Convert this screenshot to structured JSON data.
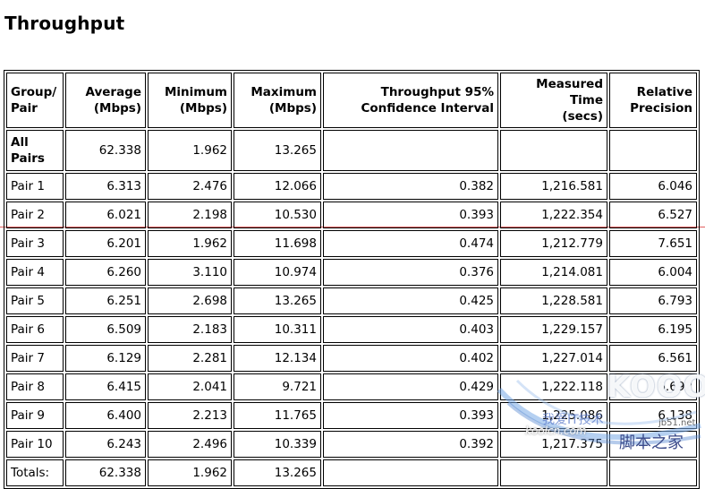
{
  "title": "Throughput",
  "table": {
    "headers": [
      [
        "Group/",
        "Pair"
      ],
      [
        "Average",
        "(Mbps)"
      ],
      [
        "Minimum",
        "(Mbps)"
      ],
      [
        "Maximum",
        "(Mbps)"
      ],
      [
        "Throughput 95%",
        "Confidence Interval"
      ],
      [
        "Measured Time",
        "(secs)"
      ],
      [
        "Relative",
        "Precision"
      ]
    ],
    "all_pairs": {
      "label": [
        "All",
        "Pairs"
      ],
      "average": "62.338",
      "minimum": "1.962",
      "maximum": "13.265",
      "ci": "",
      "time": "",
      "precision": ""
    },
    "rows": [
      {
        "label": "Pair 1",
        "average": "6.313",
        "minimum": "2.476",
        "maximum": "12.066",
        "ci": "0.382",
        "time": "1,216.581",
        "precision": "6.046"
      },
      {
        "label": "Pair 2",
        "average": "6.021",
        "minimum": "2.198",
        "maximum": "10.530",
        "ci": "0.393",
        "time": "1,222.354",
        "precision": "6.527"
      },
      {
        "label": "Pair 3",
        "average": "6.201",
        "minimum": "1.962",
        "maximum": "11.698",
        "ci": "0.474",
        "time": "1,212.779",
        "precision": "7.651"
      },
      {
        "label": "Pair 4",
        "average": "6.260",
        "minimum": "3.110",
        "maximum": "10.974",
        "ci": "0.376",
        "time": "1,214.081",
        "precision": "6.004"
      },
      {
        "label": "Pair 5",
        "average": "6.251",
        "minimum": "2.698",
        "maximum": "13.265",
        "ci": "0.425",
        "time": "1,228.581",
        "precision": "6.793"
      },
      {
        "label": "Pair 6",
        "average": "6.509",
        "minimum": "2.183",
        "maximum": "10.311",
        "ci": "0.403",
        "time": "1,229.157",
        "precision": "6.195"
      },
      {
        "label": "Pair 7",
        "average": "6.129",
        "minimum": "2.281",
        "maximum": "12.134",
        "ci": "0.402",
        "time": "1,227.014",
        "precision": "6.561"
      },
      {
        "label": "Pair 8",
        "average": "6.415",
        "minimum": "2.041",
        "maximum": "9.721",
        "ci": "0.429",
        "time": "1,222.118",
        "precision": "6.692"
      },
      {
        "label": "Pair 9",
        "average": "6.400",
        "minimum": "2.213",
        "maximum": "11.765",
        "ci": "0.393",
        "time": "1,225.086",
        "precision": "6.138"
      },
      {
        "label": "Pair 10",
        "average": "6.243",
        "minimum": "2.496",
        "maximum": "10.339",
        "ci": "0.392",
        "time": "1,217.375",
        "precision": ""
      }
    ],
    "totals": {
      "label": "Totals:",
      "average": "62.338",
      "minimum": "1.962",
      "maximum": "13.265",
      "ci": "",
      "time": "",
      "precision": ""
    }
  },
  "watermark": {
    "logo": "KOOO",
    "cn_text": "我爱IT技术",
    "kool": "koolcn.com",
    "site": "jb51.net",
    "site_cn": "脚本之家"
  },
  "colors": {
    "rule_line": "#e06060",
    "border": "#000000"
  }
}
